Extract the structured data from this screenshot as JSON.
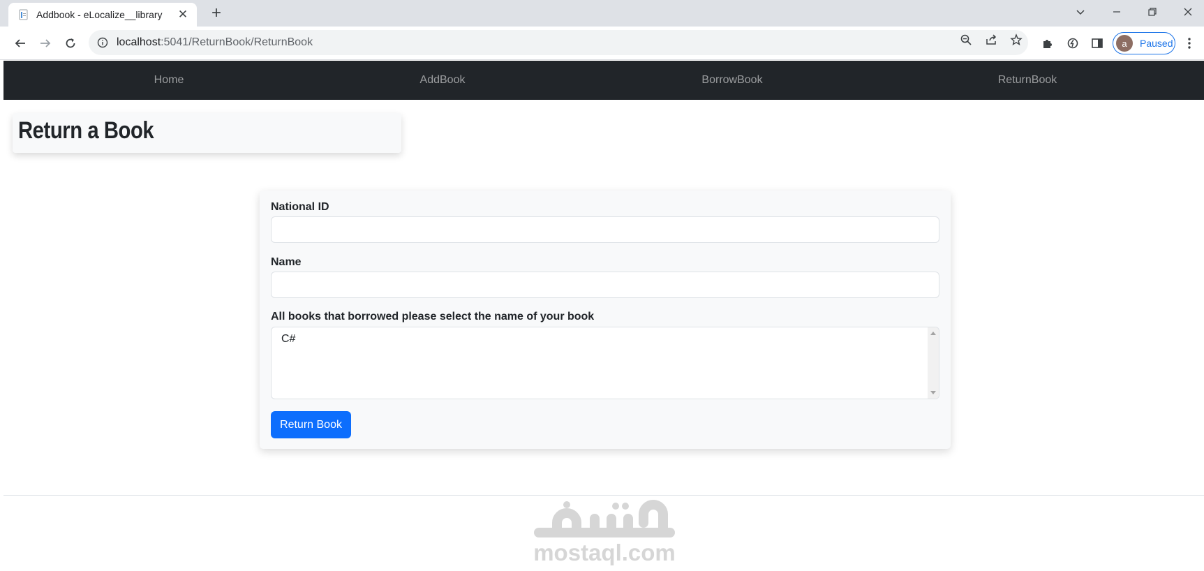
{
  "browser": {
    "tab_title": "Addbook - eLocalize__library",
    "url_host": "localhost",
    "url_rest": ":5041/ReturnBook/ReturnBook",
    "profile_initial": "a",
    "profile_status": "Paused"
  },
  "nav": {
    "items": [
      "Home",
      "AddBook",
      "BorrowBook",
      "ReturnBook"
    ]
  },
  "page": {
    "heading": "Return a Book"
  },
  "form": {
    "national_id_label": "National ID",
    "national_id_value": "",
    "name_label": "Name",
    "name_value": "",
    "books_label": "All books that borrowed please select the name of your book",
    "books_options": [
      "C#"
    ],
    "submit_label": "Return Book"
  },
  "footer": {
    "watermark_logo_text": "مستقل",
    "watermark_text": "mostaql.com"
  },
  "colors": {
    "navbar_bg": "#212529",
    "primary": "#0d6efd",
    "card_bg": "#f8f9fa"
  }
}
